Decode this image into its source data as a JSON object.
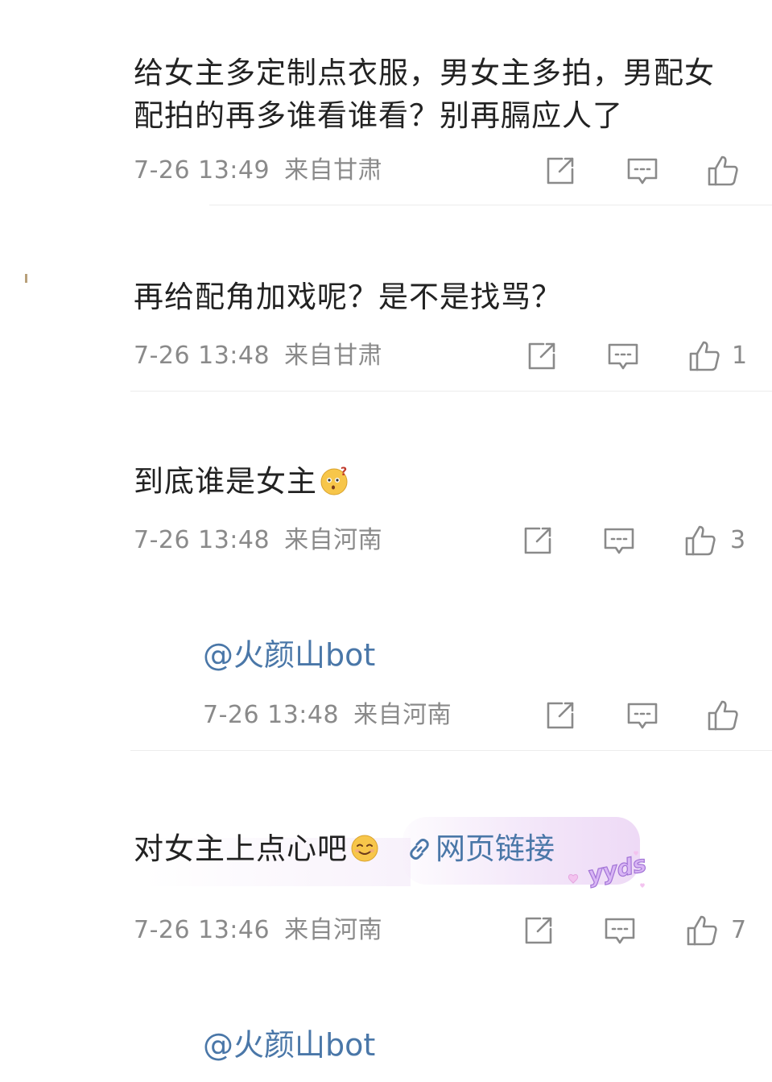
{
  "comments": [
    {
      "text_line1": "给女主多定制点衣服，男女主多拍，男配女",
      "text_line2": "配拍的再多谁看谁看？别再膈应人了",
      "time": "7-26 13:49",
      "location": "来自甘肃",
      "likes": ""
    },
    {
      "text": "再给配角加戏呢？是不是找骂？",
      "time": "7-26 13:48",
      "location": "来自甘肃",
      "likes": "1"
    },
    {
      "text": "到底谁是女主",
      "emoji": "thinking-face-emoji",
      "time": "7-26 13:48",
      "location": "来自河南",
      "likes": "3"
    },
    {
      "reply_mention": "@火颜山bot",
      "time": "7-26 13:48",
      "location": "来自河南",
      "likes": ""
    },
    {
      "text": "对女主上点心吧",
      "emoji": "smile-face-emoji",
      "link_label": "网页链接",
      "link_icon": "link-icon",
      "badge": "yyds",
      "time": "7-26 13:46",
      "location": "来自河南",
      "likes": "7"
    },
    {
      "reply_mention": "@火颜山bot"
    }
  ],
  "icons": {
    "share": "share-icon",
    "comment": "comment-icon",
    "like": "thumbs-up-icon"
  },
  "colors": {
    "text": "#222222",
    "meta": "#8a8a8a",
    "link": "#4a77a8",
    "divider": "#ececec",
    "badge": "#c58ee6"
  }
}
